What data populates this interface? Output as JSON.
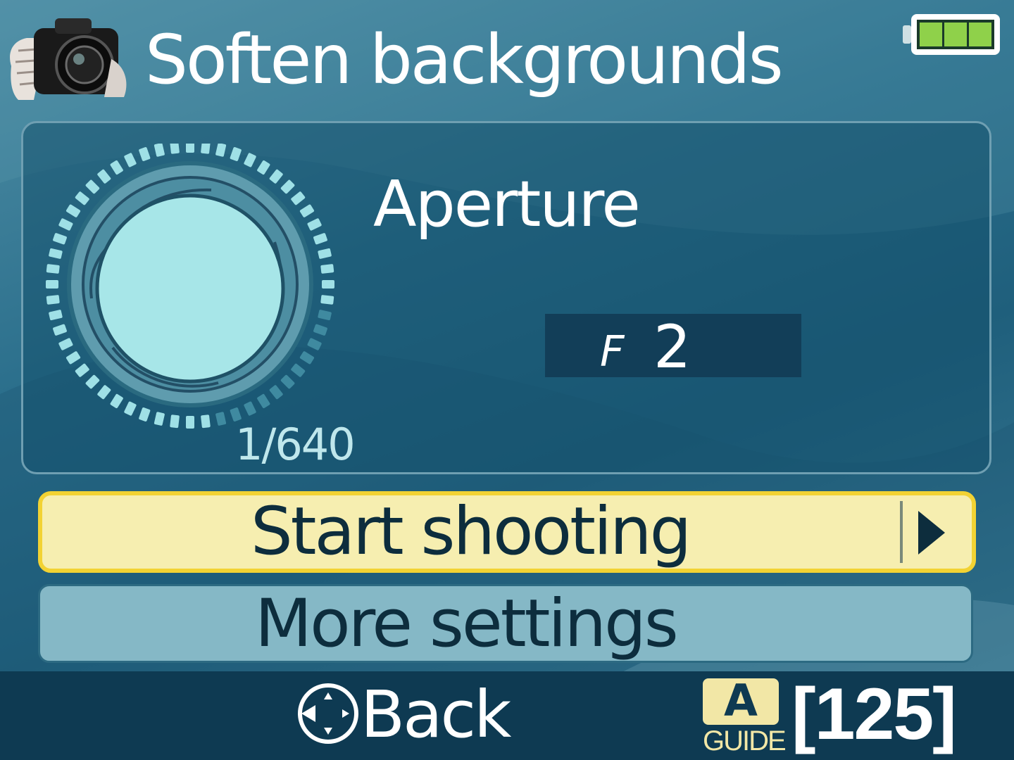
{
  "header": {
    "title": "Soften backgrounds",
    "camera_icon": "camera-icon",
    "battery_icon": "battery-full-icon",
    "battery_level": 1.0
  },
  "exposure": {
    "shutter_speed": "1/640",
    "label": "Aperture",
    "f_letter": "F",
    "f_number": "2"
  },
  "menu": {
    "start_shooting": "Start shooting",
    "more_settings": "More settings",
    "selected": "Start shooting"
  },
  "footer": {
    "back_label": "Back",
    "dpad_icon": "multi-selector-icon",
    "guide_letter": "A",
    "guide_text": "GUIDE",
    "shots_remaining": "[125]"
  },
  "colors": {
    "accent_yellow": "#f2d233",
    "highlight_bg": "#f6eeb0",
    "footer_bg": "#0e3a52",
    "dial_fill": "#a7e6e8"
  }
}
